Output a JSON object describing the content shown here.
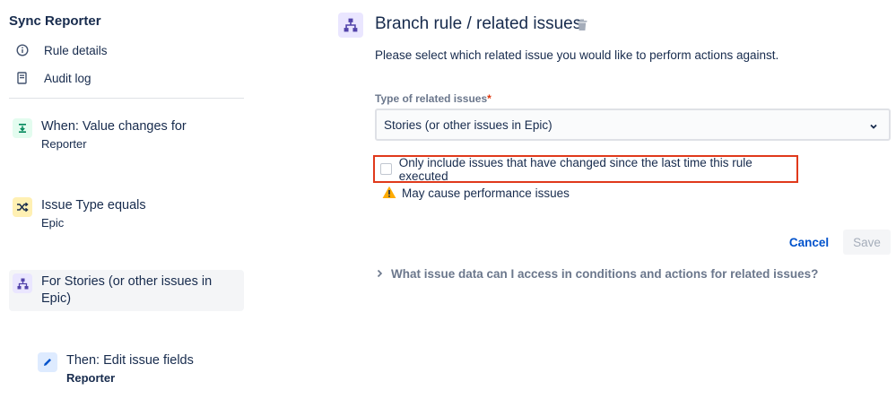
{
  "sidebar": {
    "app_title": "Sync Reporter",
    "nav": [
      {
        "label": "Rule details",
        "icon": "info-icon"
      },
      {
        "label": "Audit log",
        "icon": "document-icon"
      }
    ],
    "rules": [
      {
        "title": "When: Value changes for",
        "subtitle": "Reporter",
        "icon": "trigger-icon",
        "icon_bg": "#e3fcef",
        "icon_color": "#00875a"
      },
      {
        "title": "Issue Type equals",
        "subtitle": "Epic",
        "icon": "shuffle-icon",
        "icon_bg": "#fff0b3",
        "icon_color": "#172b4d"
      },
      {
        "title": "For Stories (or other issues in Epic)",
        "subtitle": "",
        "icon": "branch-icon",
        "icon_bg": "#eae6ff",
        "icon_color": "#5243aa"
      },
      {
        "title": "Then: Edit issue fields",
        "subtitle": "Reporter",
        "icon": "pencil-icon",
        "icon_bg": "#deebff",
        "icon_color": "#0052cc"
      }
    ]
  },
  "main": {
    "title": "Branch rule / related issues",
    "description": "Please select which related issue you would like to perform actions against.",
    "field_label": "Type of related issues",
    "required_mark": "*",
    "select_value": "Stories (or other issues in Epic)",
    "checkbox_label": "Only include issues that have changed since the last time this rule executed",
    "checkbox_checked": false,
    "warning": "May cause performance issues",
    "cancel_label": "Cancel",
    "save_label": "Save",
    "expander_label": "What issue data can I access in conditions and actions for related issues?"
  },
  "colors": {
    "accent": "#0052cc",
    "highlight_border": "#e0391b",
    "warning": "#ffab00",
    "text": "#172b4d"
  }
}
